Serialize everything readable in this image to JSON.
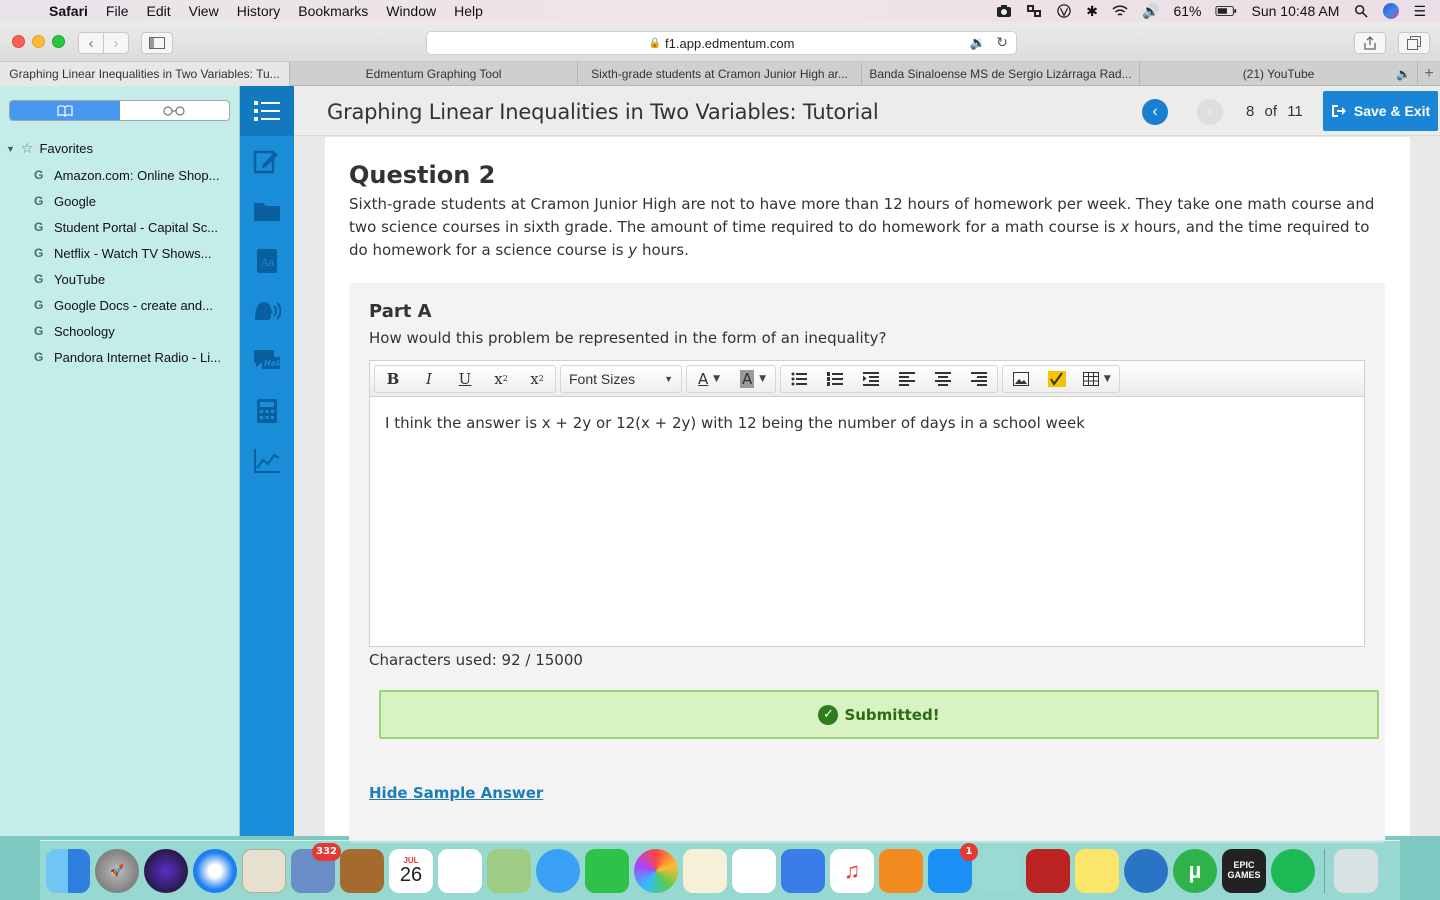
{
  "menubar": {
    "app": "Safari",
    "menus": [
      "File",
      "Edit",
      "View",
      "History",
      "Bookmarks",
      "Window",
      "Help"
    ],
    "battery": "61%",
    "clock": "Sun 10:48 AM"
  },
  "browser": {
    "url": "f1.app.edmentum.com",
    "tabs": [
      "Graphing Linear Inequalities in Two Variables: Tu...",
      "Edmentum Graphing Tool",
      "Sixth-grade students at Cramon Junior High ar...",
      "Banda Sinaloense MS de Sergio Lizárraga Rad...",
      "(21) YouTube"
    ]
  },
  "sidebar": {
    "favorites_label": "Favorites",
    "bookmarks": [
      "Amazon.com: Online Shop...",
      "Google",
      "Student Portal - Capital Sc...",
      "Netflix - Watch TV Shows...",
      "YouTube",
      "Google Docs - create and...",
      "Schoology",
      "Pandora Internet Radio - Li..."
    ]
  },
  "lesson": {
    "title": "Graphing Linear Inequalities in Two Variables: Tutorial",
    "page_current": "8",
    "page_of": "of",
    "page_total": "11",
    "save_exit": "Save & Exit"
  },
  "question": {
    "title": "Question 2",
    "text_1": "Sixth-grade students at Cramon Junior High are not to have more than 12 hours of homework per week. They take one math course and two science courses in sixth grade. The amount of time required to do homework for a math course is ",
    "var_x": "x",
    "text_2": " hours, and the time required to do homework for a science course is ",
    "var_y": "y",
    "text_3": " hours."
  },
  "part_a": {
    "title": "Part A",
    "prompt": "How would this problem be represented in the form of an inequality?",
    "font_sizes": "Font Sizes",
    "answer": "I think the answer is x + 2y or 12(x + 2y) with 12 being the number of days in a school week",
    "char_count": "Characters used: 92 / 15000",
    "submitted": "Submitted!",
    "hide_sample": "Hide Sample Answer"
  },
  "dock": {
    "mail_badge": "332",
    "calendar_month": "JUL",
    "calendar_day": "26",
    "appstore_badge": "1",
    "epic": "EPIC GAMES"
  },
  "colors": {
    "rail": "#1a8dd8",
    "save_button": "#1a85d6",
    "submitted_bg": "#d8f2c2",
    "link": "#1d7db7"
  }
}
